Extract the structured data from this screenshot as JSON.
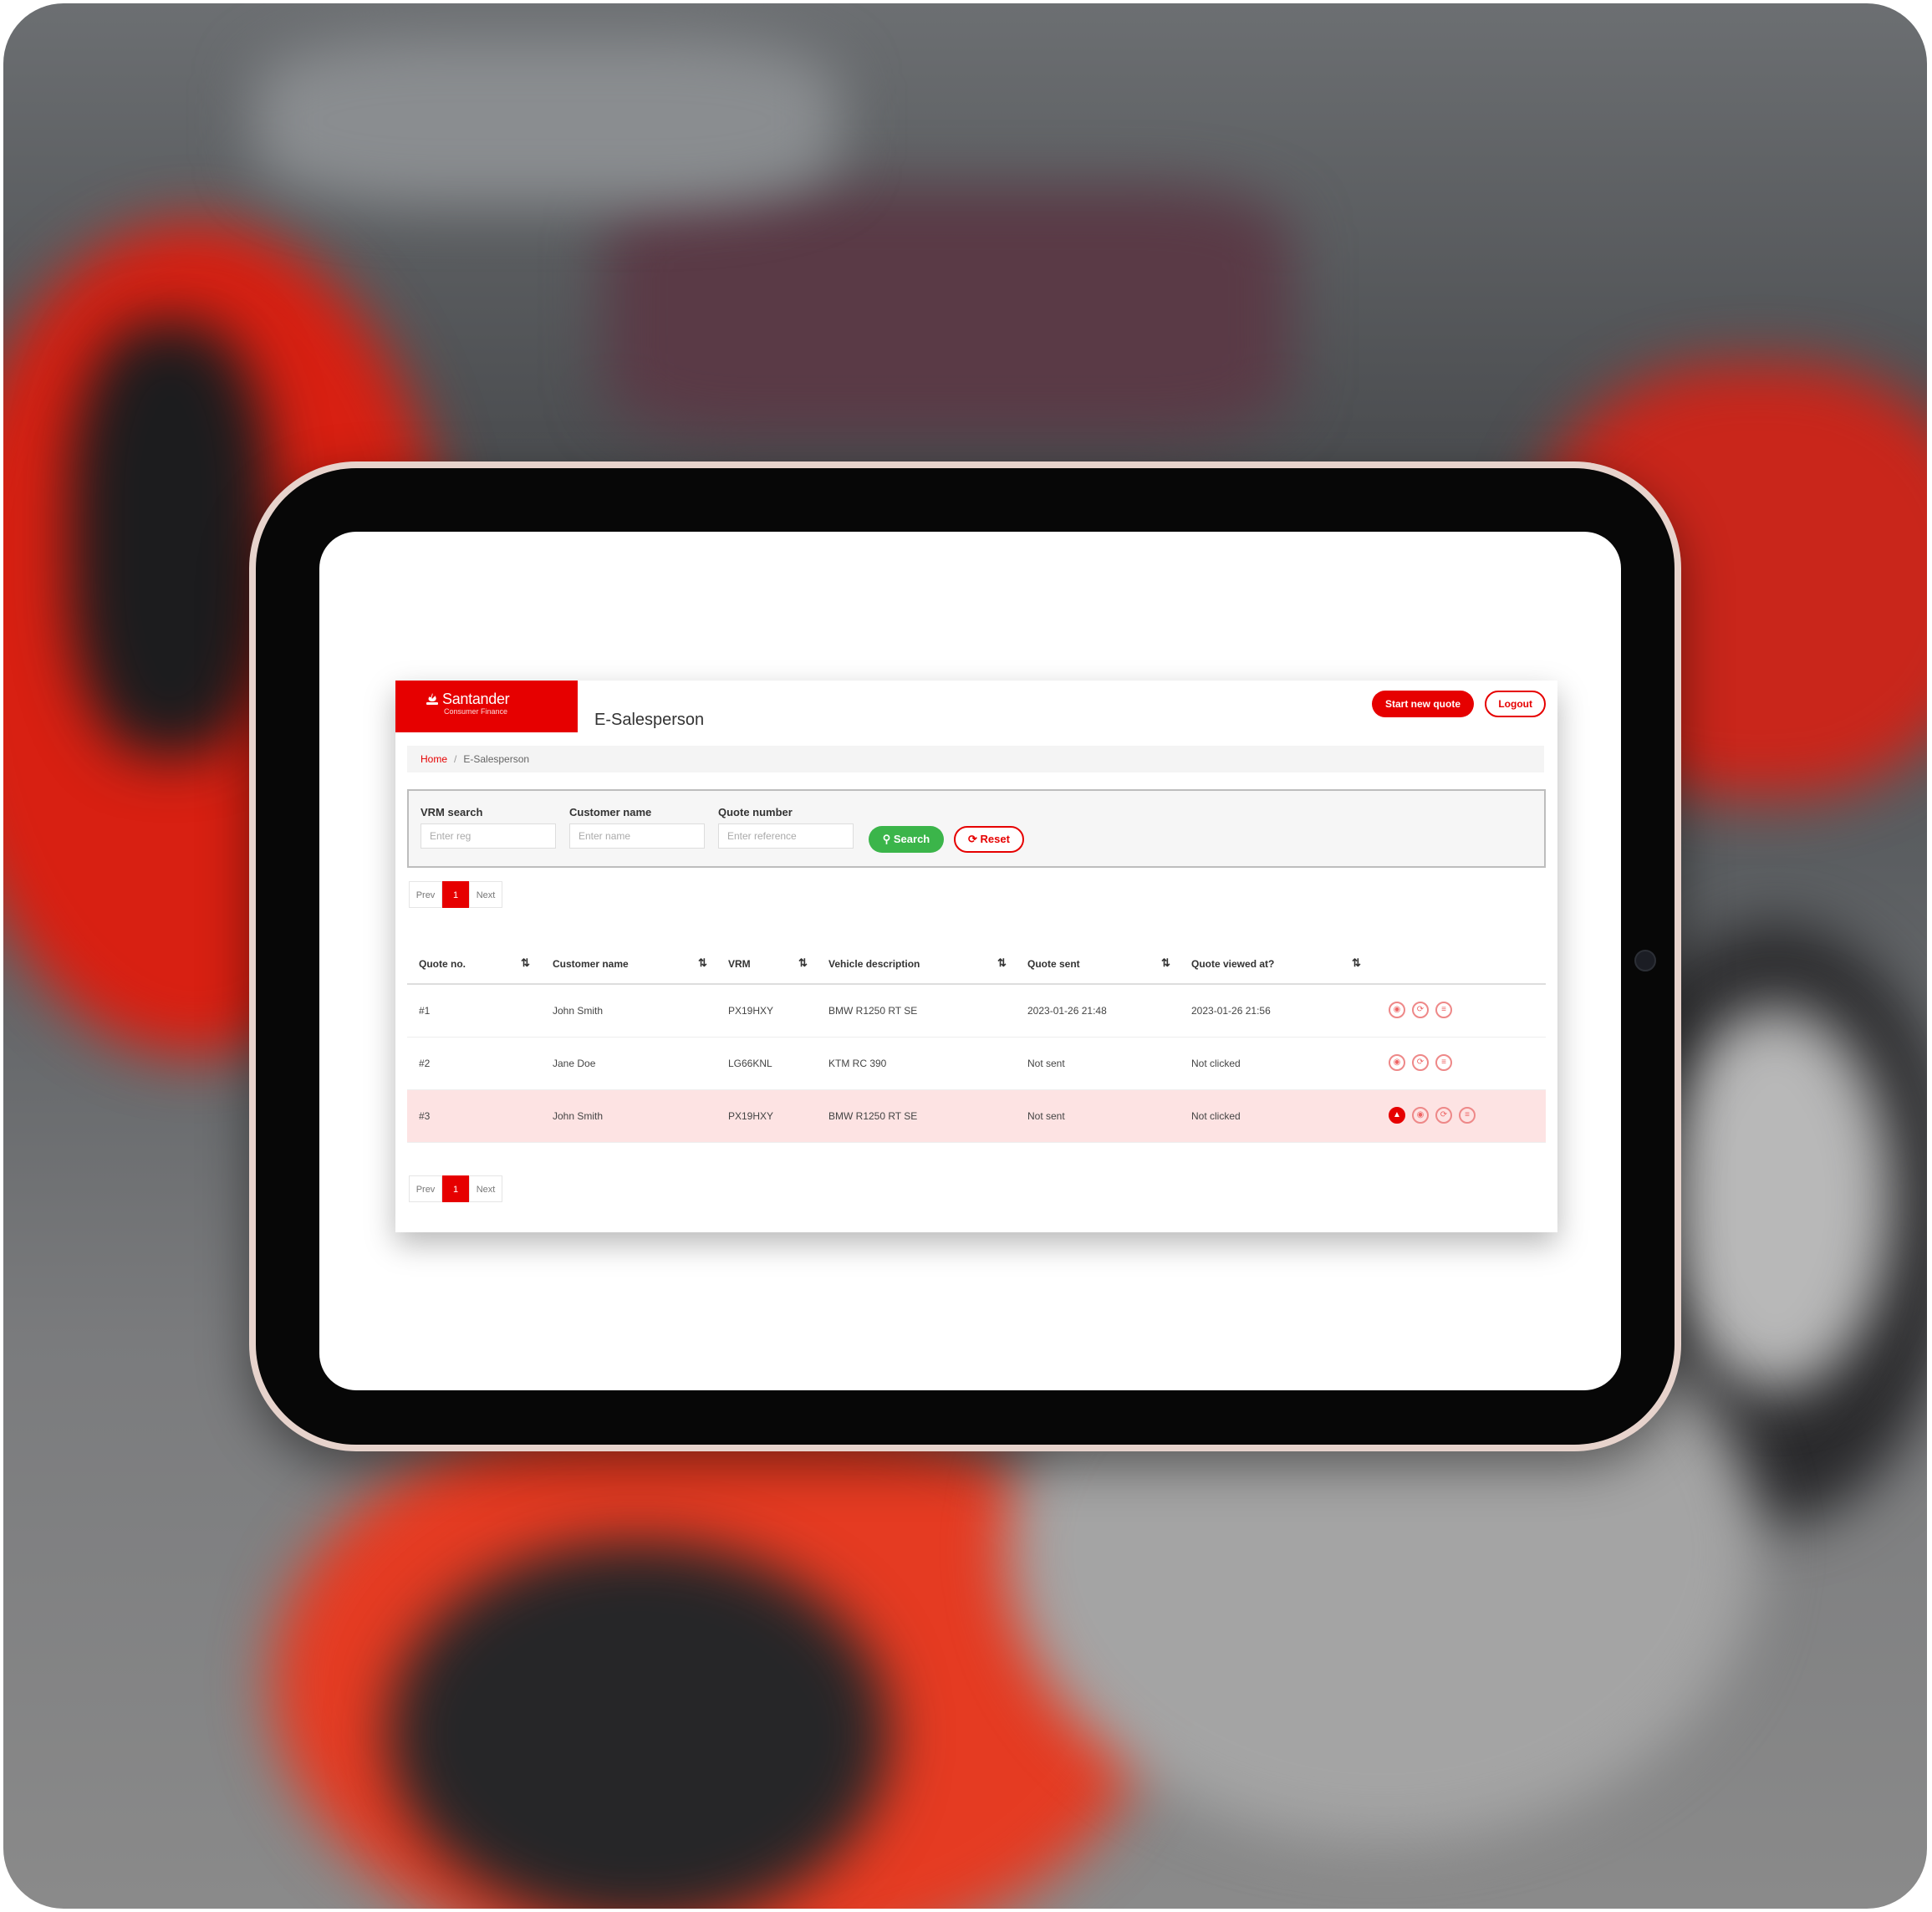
{
  "header": {
    "brand_name": "Santander",
    "brand_sub": "Consumer Finance",
    "app_title": "E-Salesperson",
    "start_new_quote": "Start new quote",
    "logout": "Logout"
  },
  "breadcrumb": {
    "home": "Home",
    "separator": "/",
    "current": "E-Salesperson"
  },
  "filters": {
    "vrm_label": "VRM search",
    "vrm_placeholder": "Enter reg",
    "customer_label": "Customer name",
    "customer_placeholder": "Enter name",
    "quote_label": "Quote number",
    "quote_placeholder": "Enter reference",
    "search_button": "Search",
    "reset_button": "Reset"
  },
  "pagination": {
    "prev": "Prev",
    "page": "1",
    "next": "Next"
  },
  "table": {
    "columns": [
      "Quote no.",
      "Customer name",
      "VRM",
      "Vehicle description",
      "Quote sent",
      "Quote viewed at?"
    ],
    "sort_icon": "⇅",
    "rows": [
      {
        "quote_no": "#1",
        "customer": "John Smith",
        "vrm": "PX19HXY",
        "vehicle": "BMW R1250 RT SE",
        "sent": "2023-01-26 21:48",
        "viewed": "2023-01-26 21:56"
      },
      {
        "quote_no": "#2",
        "customer": "Jane Doe",
        "vrm": "LG66KNL",
        "vehicle": "KTM RC 390",
        "sent": "Not sent",
        "viewed": "Not clicked"
      },
      {
        "quote_no": "#3",
        "customer": "John Smith",
        "vrm": "PX19HXY",
        "vehicle": "BMW R1250 RT SE",
        "sent": "Not sent",
        "viewed": "Not clicked"
      }
    ]
  },
  "icons": {
    "view": "view-icon",
    "copy": "copy-icon",
    "pdf": "pdf-icon",
    "alert": "alert-icon"
  },
  "colors": {
    "brand": "#e60000",
    "success": "#3bb54a",
    "highlight_row": "#fde3e3"
  }
}
